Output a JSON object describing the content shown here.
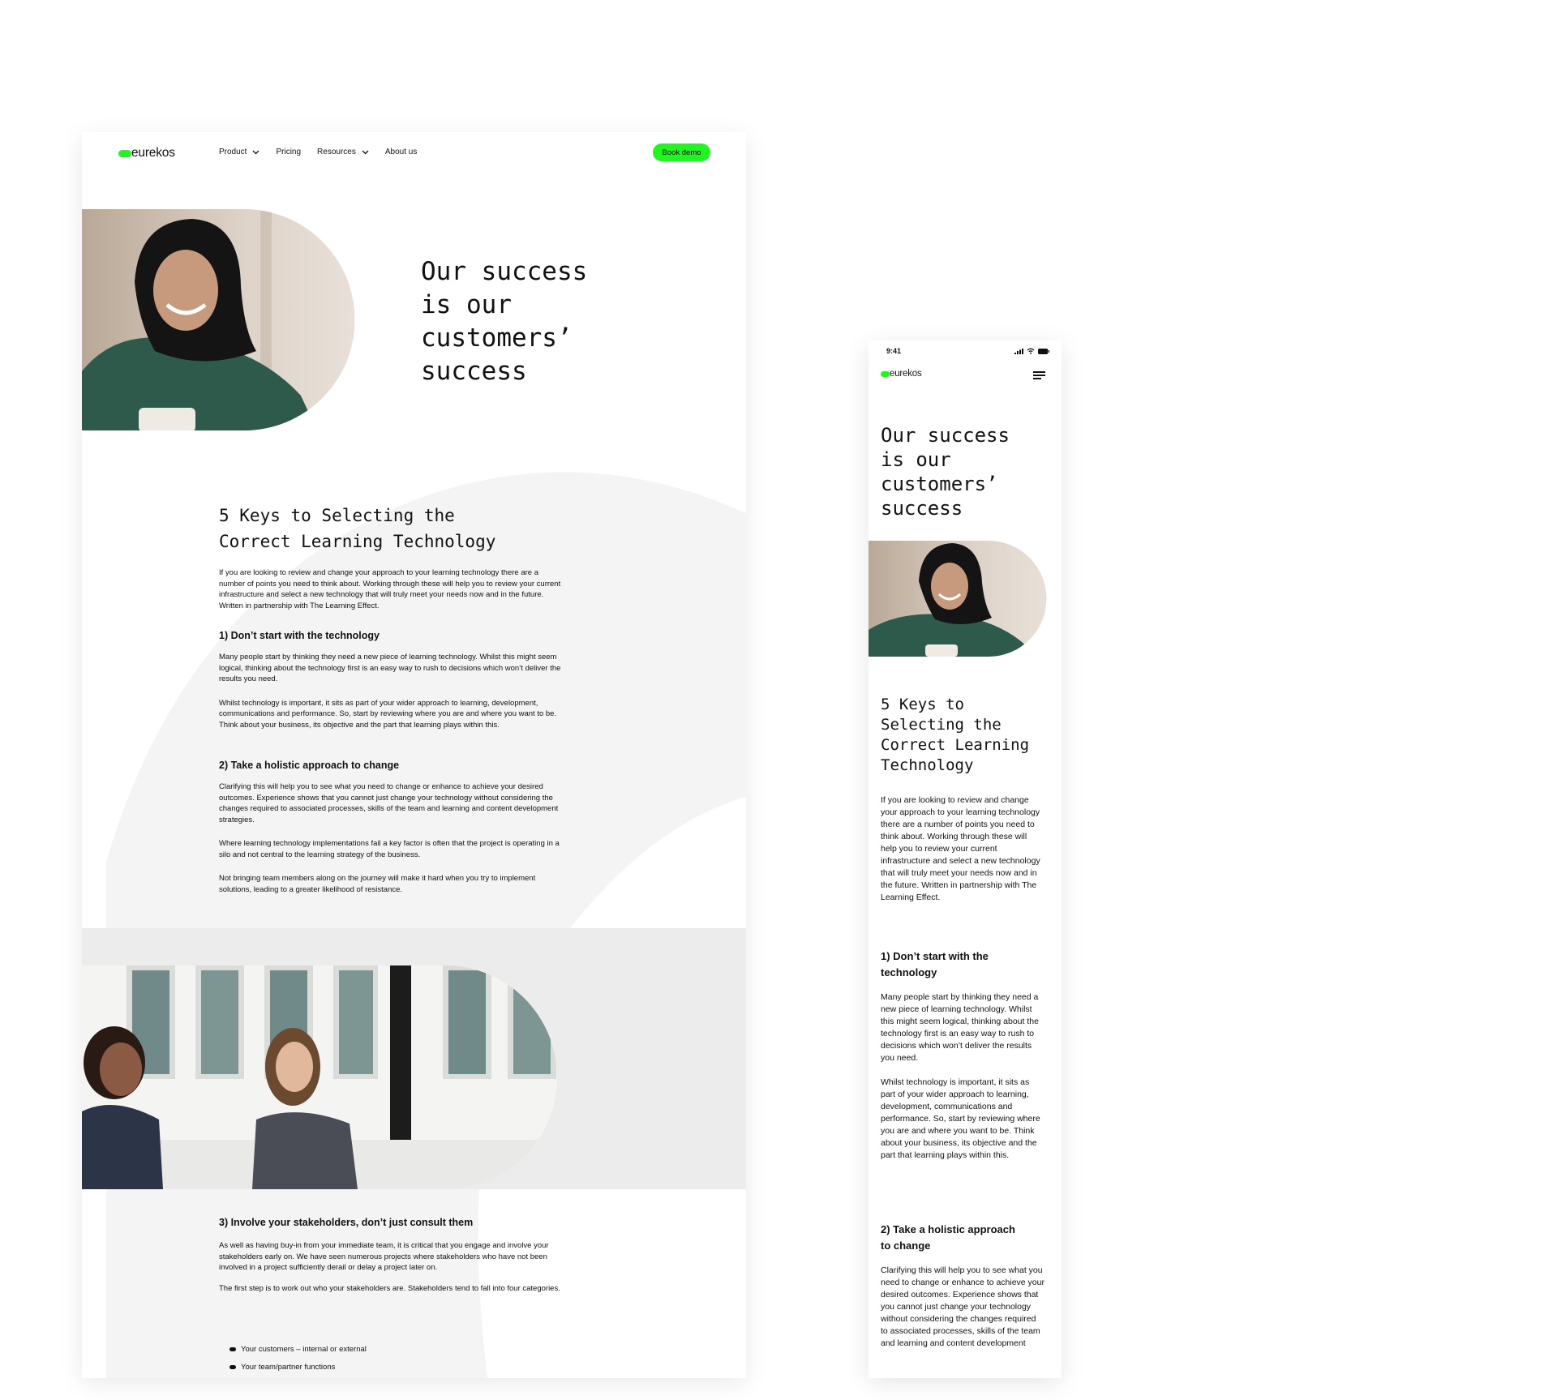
{
  "brand": {
    "name": "eurekos",
    "accent": "#21f521"
  },
  "nav": {
    "items": [
      {
        "label": "Product",
        "has_dropdown": true
      },
      {
        "label": "Pricing",
        "has_dropdown": false
      },
      {
        "label": "Resources",
        "has_dropdown": true
      },
      {
        "label": "About us",
        "has_dropdown": false
      }
    ],
    "cta": "Book demo"
  },
  "hero": {
    "title_lines": [
      "Our success",
      "is our",
      "customers’",
      "success"
    ]
  },
  "article": {
    "title_lines": [
      "5 Keys to Selecting the",
      "Correct Learning Technology"
    ],
    "intro": "If you are looking to review and change your approach to your learning technology there are a number of points you need to think about. Working through these will help you to review your current infrastructure and select a new technology that will truly meet your needs now and in the future. Written in partnership with The Learning Effect.",
    "sections": [
      {
        "heading": "1) Don’t start with the technology",
        "paragraphs": [
          "Many people start by thinking they need a new piece of learning technology. Whilst this might seem logical, thinking about the technology first is an easy way to rush to decisions which won’t deliver the results you need.",
          "Whilst technology is important, it sits as part of your wider approach to learning, development, communications and performance. So, start by reviewing where you are and where you want to be. Think about your business, its objective and the part that learning plays within this."
        ]
      },
      {
        "heading": "2) Take a holistic approach to change",
        "paragraphs": [
          "Clarifying this will help you to see what you need to change or enhance to achieve your desired outcomes. Experience shows that you cannot just change your technology without considering the changes required to associated processes, skills of the team and learning and content development strategies.",
          "Where learning technology implementations fail a key factor is often that the project is operating in a silo and not central to the learning strategy of the business.",
          "Not bringing team members along on the journey will make it hard when you try to implement solutions, leading to a greater likelihood of resistance."
        ]
      },
      {
        "heading": "3) Involve your stakeholders, don’t just consult them",
        "paragraphs": [
          "As well as having buy-in from your immediate team, it is critical that you engage and involve your stakeholders early on. We have seen numerous projects where stakeholders who have not been involved in a project sufficiently derail or delay a project later on.",
          "The first step is to work out who your stakeholders are. Stakeholders tend to fall into four categories."
        ],
        "bullets": [
          "Your customers – internal or external",
          "Your team/partner functions"
        ]
      }
    ]
  },
  "mobile": {
    "status_time": "9:41",
    "hero_title_lines": [
      "Our success",
      "is our",
      "customers’",
      "success"
    ],
    "article_title_lines": [
      "5 Keys to",
      "Selecting the",
      "Correct Learning",
      "Technology"
    ],
    "section1_heading_lines": [
      "1) Don’t start with the",
      "technology"
    ],
    "section2_heading_lines": [
      "2) Take a holistic approach",
      "to change"
    ],
    "section2_para_visible": "Clarifying this will help you to see what you need to change or enhance to achieve your desired outcomes. Experience shows that you cannot just change your technology without considering the changes required to associated processes, skills of the team and learning and content development"
  }
}
